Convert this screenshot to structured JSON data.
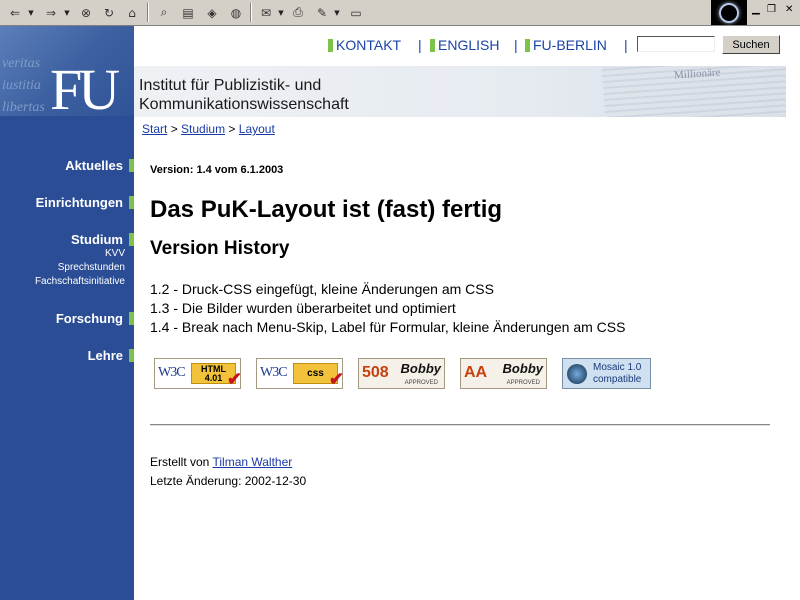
{
  "toolbar": {
    "back_icon": "arrow-left-icon",
    "forward_icon": "arrow-right-icon",
    "stop_icon": "stop-icon",
    "refresh_icon": "refresh-icon",
    "home_icon": "home-icon",
    "search_icon": "search-icon",
    "favorites_icon": "folder-icon",
    "history_icon": "shield-icon",
    "media_icon": "globe-icon",
    "mail_icon": "mail-icon",
    "print_icon": "printer-icon",
    "edit_icon": "edit-icon",
    "discuss_icon": "document-icon"
  },
  "header": {
    "links": [
      "KONTAKT",
      "ENGLISH",
      "FU-BERLIN"
    ],
    "search_value": "",
    "search_button": "Suchen",
    "logo": "FU",
    "institute_line1": "Institut für Publizistik- und",
    "institute_line2": "Kommunikationswissenschaft"
  },
  "breadcrumb": [
    "Start",
    "Studium",
    "Layout"
  ],
  "breadcrumb_sep": ">",
  "nav": {
    "items": [
      "Aktuelles",
      "Einrichtungen",
      "Studium",
      "Forschung",
      "Lehre"
    ],
    "studium_sub": [
      "KVV",
      "Sprechstunden",
      "Fachschaftsinitiative"
    ]
  },
  "main": {
    "version": "Version: 1.4 vom 6.1.2003",
    "heading": "Das PuK-Layout ist (fast) fertig",
    "subheading": "Version History",
    "history": [
      "1.2 - Druck-CSS eingefügt, kleine Änderungen am CSS",
      "1.3 - Die Bilder wurden überarbeitet und optimiert",
      "1.4 - Break nach Menu-Skip, Label für Formular, kleine Änderungen am CSS"
    ],
    "badges": {
      "w3c": "W3C",
      "html": "HTML",
      "html_ver": "4.01",
      "css": "css",
      "bobby_508": "508",
      "bobby_aa": "AA",
      "bobby": "Bobby",
      "approved": "APPROVED",
      "mosaic1": "Mosaic 1.0",
      "mosaic2": "compatible"
    },
    "created_prefix": "Erstellt von",
    "author": "Tilman Walther",
    "updated": "Letzte Änderung: 2002-12-30"
  },
  "colors": {
    "sidebar": "#2a4d95",
    "accent_green": "#7dc24a",
    "link": "#1a44a5"
  }
}
